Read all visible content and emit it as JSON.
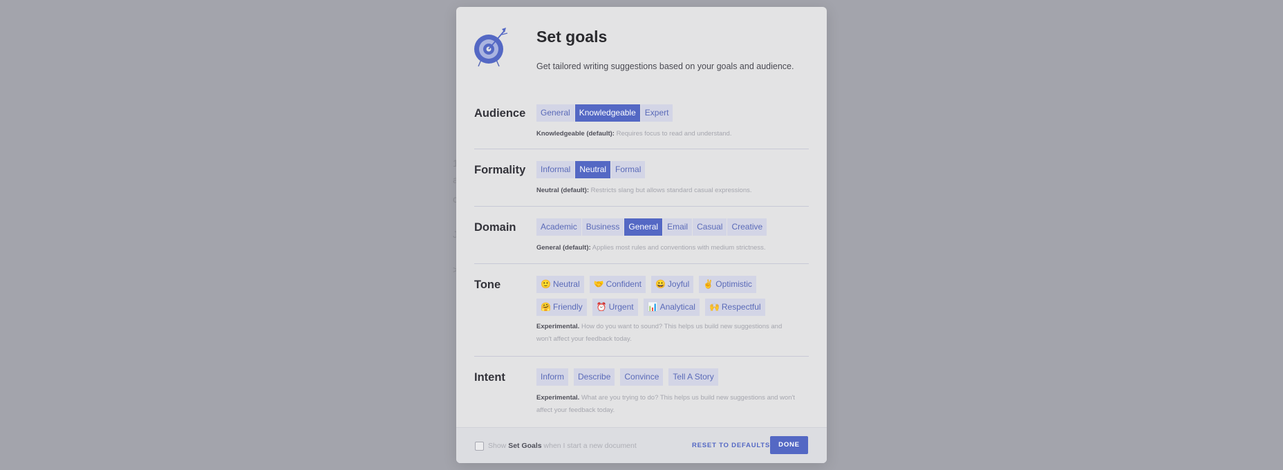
{
  "background_snippets": [
    "1",
    "a",
    "c",
    "J",
    ">"
  ],
  "modal": {
    "title": "Set goals",
    "subtitle": "Get tailored writing suggestions based on your goals and audience.",
    "logo_icon": "target-arrow-icon"
  },
  "sections": {
    "audience": {
      "label": "Audience",
      "options": [
        "General",
        "Knowledgeable",
        "Expert"
      ],
      "selected": "Knowledgeable",
      "desc_bold": "Knowledgeable (default):",
      "desc_text": " Requires focus to read and understand."
    },
    "formality": {
      "label": "Formality",
      "options": [
        "Informal",
        "Neutral",
        "Formal"
      ],
      "selected": "Neutral",
      "desc_bold": "Neutral (default):",
      "desc_text": " Restricts slang but allows standard casual expressions."
    },
    "domain": {
      "label": "Domain",
      "options": [
        "Academic",
        "Business",
        "General",
        "Email",
        "Casual",
        "Creative"
      ],
      "selected": "General",
      "desc_bold": "General (default):",
      "desc_text": " Applies most rules and conventions with medium strictness."
    },
    "tone": {
      "label": "Tone",
      "chips": [
        {
          "emoji": "🙂",
          "label": "Neutral"
        },
        {
          "emoji": "🤝",
          "label": "Confident"
        },
        {
          "emoji": "😀",
          "label": "Joyful"
        },
        {
          "emoji": "✌",
          "label": "Optimistic"
        },
        {
          "emoji": "🤗",
          "label": "Friendly"
        },
        {
          "emoji": "⏰",
          "label": "Urgent"
        },
        {
          "emoji": "📊",
          "label": "Analytical"
        },
        {
          "emoji": "🙌",
          "label": "Respectful"
        }
      ],
      "desc_bold": "Experimental.",
      "desc_line1": " How do you want to sound? This helps us build new suggestions and",
      "desc_line2": "won't affect your feedback today."
    },
    "intent": {
      "label": "Intent",
      "chips": [
        {
          "label": "Inform"
        },
        {
          "label": "Describe"
        },
        {
          "label": "Convince"
        },
        {
          "label": "Tell A Story"
        }
      ],
      "desc_bold": "Experimental.",
      "desc_line1": " What are you trying to do? This helps us build new suggestions and won't",
      "desc_line2": "affect your feedback today."
    }
  },
  "footer": {
    "checkbox_checked": false,
    "cb_pre": "Show ",
    "cb_bold": "Set Goals",
    "cb_post": " when I start a new document",
    "reset_label": "RESET TO DEFAULTS",
    "done_label": "DONE"
  },
  "colors": {
    "accent": "#5468c4",
    "option_bg": "#d3d5e6",
    "overlay": "#a3a4ac",
    "modal_bg": "#e3e3e4"
  }
}
